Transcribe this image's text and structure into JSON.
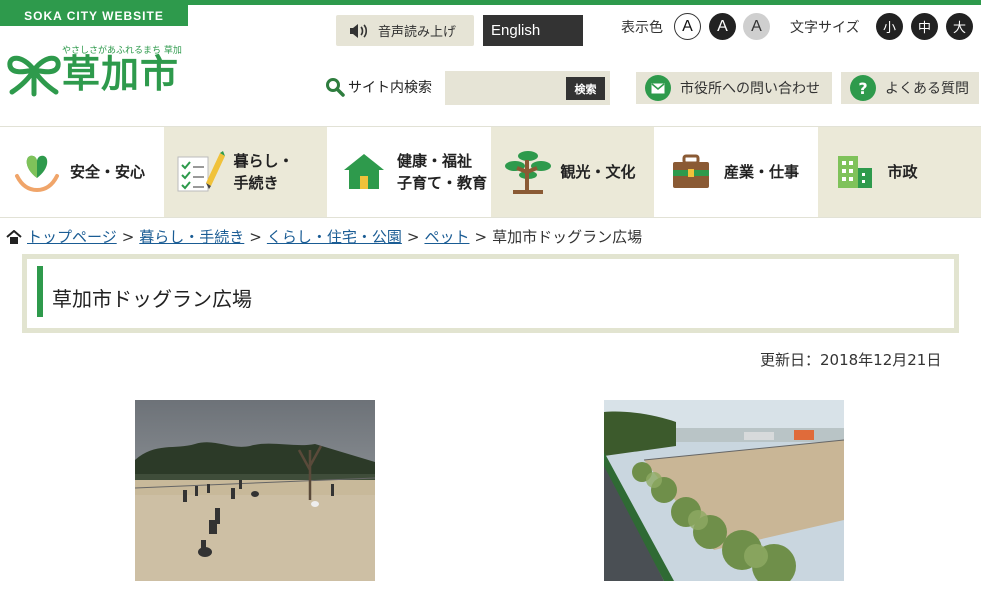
{
  "header": {
    "site_tag": "SOKA CITY WEBSITE",
    "logo_subtitle": "やさしさがあふれるまち 草加",
    "logo_name": "草加市",
    "voice_button": "音声読み上げ",
    "english_button": "English",
    "display_color_label": "表示色",
    "color_options": [
      "A",
      "A",
      "A"
    ],
    "text_size_label": "文字サイズ",
    "size_options": [
      "小",
      "中",
      "大"
    ],
    "search_label": "サイト内検索",
    "search_placeholder": "",
    "search_button": "検索",
    "contact_button": "市役所への問い合わせ",
    "faq_button": "よくある質問"
  },
  "gnav": {
    "items": [
      {
        "label_line1": "安全・安心",
        "label_line2": "",
        "icon": "heart-hands-icon"
      },
      {
        "label_line1": "暮らし・",
        "label_line2": "手続き",
        "icon": "checklist-pencil-icon"
      },
      {
        "label_line1": "健康・福祉",
        "label_line2": "子育て・教育",
        "icon": "house-icon"
      },
      {
        "label_line1": "観光・文化",
        "label_line2": "",
        "icon": "pine-tree-icon"
      },
      {
        "label_line1": "産業・仕事",
        "label_line2": "",
        "icon": "briefcase-icon"
      },
      {
        "label_line1": "市政",
        "label_line2": "",
        "icon": "building-icon"
      }
    ]
  },
  "breadcrumb": {
    "items": [
      "トップページ",
      "暮らし・手続き",
      "くらし・住宅・公園",
      "ペット"
    ],
    "current": "草加市ドッグラン広場",
    "separator": ">"
  },
  "page": {
    "title": "草加市ドッグラン広場",
    "updated": "更新日：2018年12月21日"
  },
  "colors": {
    "brand_green": "#2e9a4c",
    "nav_beige": "#ebe9d8",
    "button_beige": "#e6e4d6"
  }
}
